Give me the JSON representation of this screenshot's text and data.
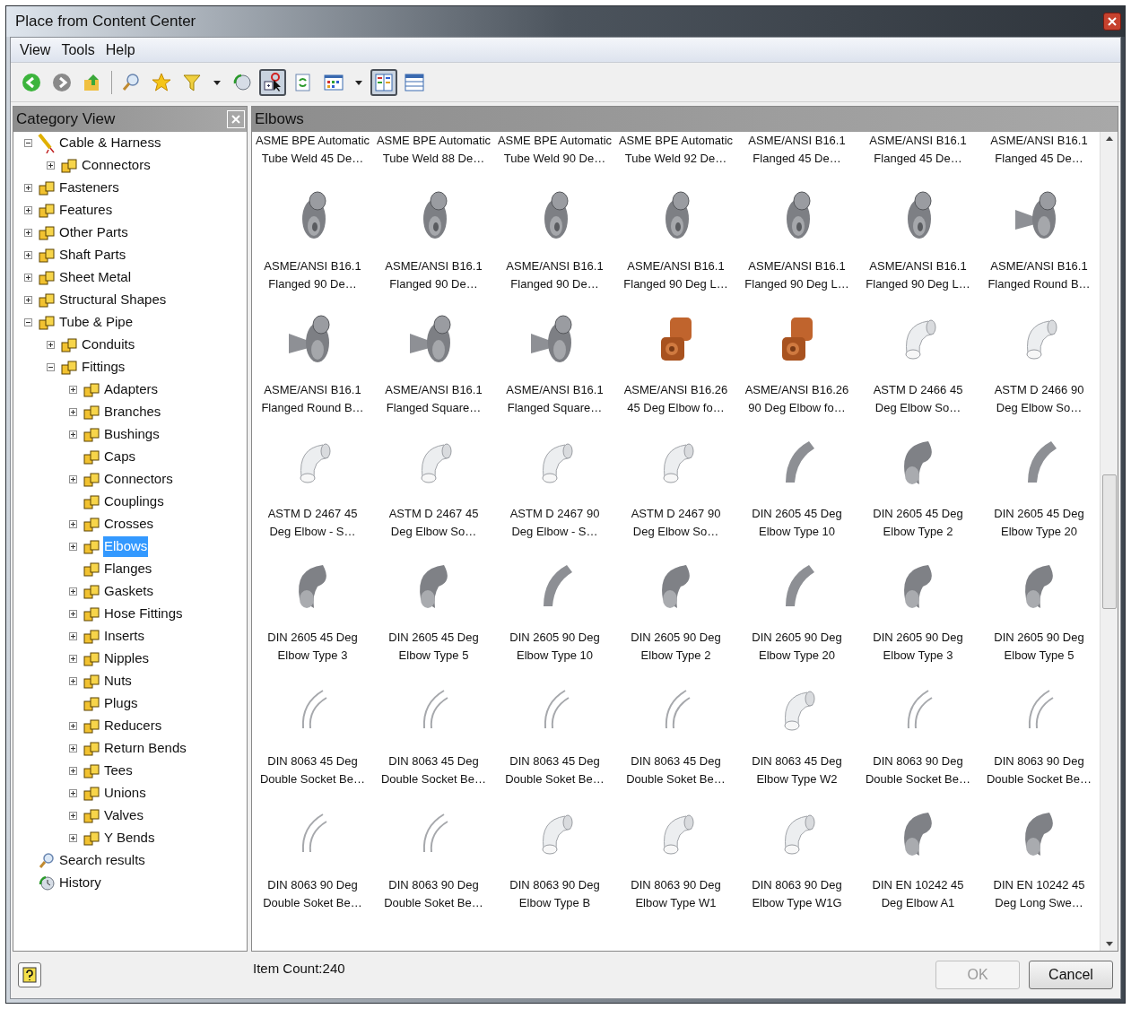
{
  "window": {
    "title": "Place from Content Center"
  },
  "menu": [
    "View",
    "Tools",
    "Help"
  ],
  "toolbar": [
    {
      "kind": "back",
      "pressed": false
    },
    {
      "kind": "forward",
      "pressed": false
    },
    {
      "kind": "up",
      "pressed": false
    },
    {
      "kind": "sep"
    },
    {
      "kind": "search",
      "pressed": false
    },
    {
      "kind": "star",
      "pressed": false
    },
    {
      "kind": "filter",
      "pressed": false
    },
    {
      "kind": "caret",
      "pressed": false
    },
    {
      "kind": "refresh-globe",
      "pressed": false
    },
    {
      "kind": "place",
      "pressed": true
    },
    {
      "kind": "refresh",
      "pressed": false
    },
    {
      "kind": "view",
      "pressed": false
    },
    {
      "kind": "caret",
      "pressed": false
    },
    {
      "kind": "list",
      "pressed": true
    },
    {
      "kind": "table",
      "pressed": false
    }
  ],
  "category_view": {
    "title": "Category View",
    "tree": [
      {
        "label": "Cable & Harness",
        "kind": "cable",
        "expanded": true,
        "selected": false,
        "children": [
          {
            "label": "Connectors",
            "kind": "part",
            "expanded": false,
            "selected": false
          }
        ]
      },
      {
        "label": "Fasteners",
        "kind": "part",
        "expanded": false,
        "selected": false
      },
      {
        "label": "Features",
        "kind": "part",
        "expanded": false,
        "selected": false
      },
      {
        "label": "Other Parts",
        "kind": "part",
        "expanded": false,
        "selected": false
      },
      {
        "label": "Shaft Parts",
        "kind": "part",
        "expanded": false,
        "selected": false
      },
      {
        "label": "Sheet Metal",
        "kind": "part",
        "expanded": false,
        "selected": false
      },
      {
        "label": "Structural Shapes",
        "kind": "part",
        "expanded": false,
        "selected": false
      },
      {
        "label": "Tube & Pipe",
        "kind": "part",
        "expanded": true,
        "selected": false,
        "children": [
          {
            "label": "Conduits",
            "kind": "part",
            "expanded": false,
            "selected": false
          },
          {
            "label": "Fittings",
            "kind": "part",
            "expanded": true,
            "selected": false,
            "children": [
              {
                "label": "Adapters",
                "kind": "part",
                "expanded": false,
                "selected": false
              },
              {
                "label": "Branches",
                "kind": "part",
                "expanded": false,
                "selected": false
              },
              {
                "label": "Bushings",
                "kind": "part",
                "expanded": false,
                "selected": false
              },
              {
                "label": "Caps",
                "kind": "part",
                "selected": false
              },
              {
                "label": "Connectors",
                "kind": "part",
                "expanded": false,
                "selected": false
              },
              {
                "label": "Couplings",
                "kind": "part",
                "selected": false
              },
              {
                "label": "Crosses",
                "kind": "part",
                "expanded": false,
                "selected": false
              },
              {
                "label": "Elbows",
                "kind": "part",
                "expanded": false,
                "selected": true
              },
              {
                "label": "Flanges",
                "kind": "part",
                "selected": false
              },
              {
                "label": "Gaskets",
                "kind": "part",
                "expanded": false,
                "selected": false
              },
              {
                "label": "Hose Fittings",
                "kind": "part",
                "expanded": false,
                "selected": false
              },
              {
                "label": "Inserts",
                "kind": "part",
                "expanded": false,
                "selected": false
              },
              {
                "label": "Nipples",
                "kind": "part",
                "expanded": false,
                "selected": false
              },
              {
                "label": "Nuts",
                "kind": "part",
                "expanded": false,
                "selected": false
              },
              {
                "label": "Plugs",
                "kind": "part",
                "selected": false
              },
              {
                "label": "Reducers",
                "kind": "part",
                "expanded": false,
                "selected": false
              },
              {
                "label": "Return Bends",
                "kind": "part",
                "expanded": false,
                "selected": false
              },
              {
                "label": "Tees",
                "kind": "part",
                "expanded": false,
                "selected": false
              },
              {
                "label": "Unions",
                "kind": "part",
                "expanded": false,
                "selected": false
              },
              {
                "label": "Valves",
                "kind": "part",
                "expanded": false,
                "selected": false
              },
              {
                "label": "Y Bends",
                "kind": "part",
                "expanded": false,
                "selected": false
              }
            ]
          }
        ]
      },
      {
        "label": "Search results",
        "kind": "search",
        "selected": false
      },
      {
        "label": "History",
        "kind": "history",
        "selected": false
      }
    ]
  },
  "items_pane": {
    "title": "Elbows",
    "items": [
      {
        "kind": "none",
        "lines": [
          "ASME BPE Automatic",
          "Tube Weld 45 De…"
        ]
      },
      {
        "kind": "none",
        "lines": [
          "ASME BPE Automatic",
          "Tube Weld 88 De…"
        ]
      },
      {
        "kind": "none",
        "lines": [
          "ASME BPE Automatic",
          "Tube Weld 90 De…"
        ]
      },
      {
        "kind": "none",
        "lines": [
          "ASME BPE Automatic",
          "Tube Weld 92 De…"
        ]
      },
      {
        "kind": "none",
        "lines": [
          "ASME/ANSI B16.1",
          "Flanged 45 De…"
        ]
      },
      {
        "kind": "none",
        "lines": [
          "ASME/ANSI B16.1",
          "Flanged 45 De…"
        ]
      },
      {
        "kind": "none",
        "lines": [
          "ASME/ANSI B16.1",
          "Flanged 45 De…"
        ]
      },
      {
        "kind": "flange",
        "lines": [
          "ASME/ANSI B16.1",
          "Flanged 90 De…"
        ]
      },
      {
        "kind": "flange",
        "lines": [
          "ASME/ANSI B16.1",
          "Flanged 90 De…"
        ]
      },
      {
        "kind": "flange",
        "lines": [
          "ASME/ANSI B16.1",
          "Flanged 90 De…"
        ]
      },
      {
        "kind": "flange",
        "lines": [
          "ASME/ANSI B16.1",
          "Flanged 90 Deg L…"
        ]
      },
      {
        "kind": "flange",
        "lines": [
          "ASME/ANSI B16.1",
          "Flanged 90 Deg L…"
        ]
      },
      {
        "kind": "flange",
        "lines": [
          "ASME/ANSI B16.1",
          "Flanged 90 Deg L…"
        ]
      },
      {
        "kind": "branch",
        "lines": [
          "ASME/ANSI B16.1",
          "Flanged Round B…"
        ]
      },
      {
        "kind": "branch",
        "lines": [
          "ASME/ANSI B16.1",
          "Flanged Round B…"
        ]
      },
      {
        "kind": "branch",
        "lines": [
          "ASME/ANSI B16.1",
          "Flanged Square…"
        ]
      },
      {
        "kind": "branch",
        "lines": [
          "ASME/ANSI B16.1",
          "Flanged Square…"
        ]
      },
      {
        "kind": "bronze",
        "lines": [
          "ASME/ANSI B16.26",
          "45 Deg Elbow fo…"
        ]
      },
      {
        "kind": "bronze",
        "lines": [
          "ASME/ANSI B16.26",
          "90 Deg Elbow fo…"
        ]
      },
      {
        "kind": "plastic",
        "lines": [
          "ASTM D 2466 45",
          "Deg Elbow So…"
        ]
      },
      {
        "kind": "plastic",
        "lines": [
          "ASTM D 2466 90",
          "Deg Elbow So…"
        ]
      },
      {
        "kind": "plastic",
        "lines": [
          "ASTM D 2467 45",
          "Deg Elbow - S…"
        ]
      },
      {
        "kind": "plastic",
        "lines": [
          "ASTM D 2467 45",
          "Deg Elbow So…"
        ]
      },
      {
        "kind": "plastic",
        "lines": [
          "ASTM D 2467 90",
          "Deg Elbow - S…"
        ]
      },
      {
        "kind": "plastic",
        "lines": [
          "ASTM D 2467 90",
          "Deg Elbow So…"
        ]
      },
      {
        "kind": "bend",
        "lines": [
          "DIN 2605 45 Deg",
          "Elbow Type 10"
        ]
      },
      {
        "kind": "solid",
        "lines": [
          "DIN 2605 45 Deg",
          "Elbow Type 2"
        ]
      },
      {
        "kind": "bend",
        "lines": [
          "DIN 2605 45 Deg",
          "Elbow Type 20"
        ]
      },
      {
        "kind": "solid",
        "lines": [
          "DIN 2605 45 Deg",
          "Elbow Type 3"
        ]
      },
      {
        "kind": "solid",
        "lines": [
          "DIN 2605 45 Deg",
          "Elbow Type 5"
        ]
      },
      {
        "kind": "bend",
        "lines": [
          "DIN 2605 90 Deg",
          "Elbow Type 10"
        ]
      },
      {
        "kind": "solid",
        "lines": [
          "DIN 2605 90 Deg",
          "Elbow Type 2"
        ]
      },
      {
        "kind": "bend",
        "lines": [
          "DIN 2605 90 Deg",
          "Elbow Type 20"
        ]
      },
      {
        "kind": "solid",
        "lines": [
          "DIN 2605 90 Deg",
          "Elbow Type 3"
        ]
      },
      {
        "kind": "solid",
        "lines": [
          "DIN 2605 90 Deg",
          "Elbow Type 5"
        ]
      },
      {
        "kind": "outline",
        "lines": [
          "DIN 8063 45 Deg",
          "Double Socket Be…"
        ]
      },
      {
        "kind": "outline",
        "lines": [
          "DIN 8063 45 Deg",
          "Double Socket Be…"
        ]
      },
      {
        "kind": "outline",
        "lines": [
          "DIN 8063 45 Deg",
          "Double Soket Be…"
        ]
      },
      {
        "kind": "outline",
        "lines": [
          "DIN 8063 45 Deg",
          "Double Soket Be…"
        ]
      },
      {
        "kind": "plastic",
        "lines": [
          "DIN 8063 45 Deg",
          "Elbow Type W2"
        ]
      },
      {
        "kind": "outline",
        "lines": [
          "DIN 8063 90 Deg",
          "Double Socket Be…"
        ]
      },
      {
        "kind": "outline",
        "lines": [
          "DIN 8063 90 Deg",
          "Double Socket Be…"
        ]
      },
      {
        "kind": "outline",
        "lines": [
          "DIN 8063 90 Deg",
          "Double Soket Be…"
        ]
      },
      {
        "kind": "outline",
        "lines": [
          "DIN 8063 90 Deg",
          "Double Soket Be…"
        ]
      },
      {
        "kind": "plastic",
        "lines": [
          "DIN 8063 90 Deg",
          "Elbow Type B"
        ]
      },
      {
        "kind": "plastic",
        "lines": [
          "DIN 8063 90 Deg",
          "Elbow Type W1"
        ]
      },
      {
        "kind": "plastic",
        "lines": [
          "DIN 8063 90 Deg",
          "Elbow Type W1G"
        ]
      },
      {
        "kind": "solid",
        "lines": [
          "DIN EN 10242 45",
          "Deg Elbow A1"
        ]
      },
      {
        "kind": "solid",
        "lines": [
          "DIN EN 10242 45",
          "Deg Long Swe…"
        ]
      }
    ]
  },
  "status": {
    "item_count": "Item Count:240"
  },
  "buttons": [
    {
      "label": "OK",
      "disabled": true
    },
    {
      "label": "Cancel",
      "disabled": false
    }
  ]
}
